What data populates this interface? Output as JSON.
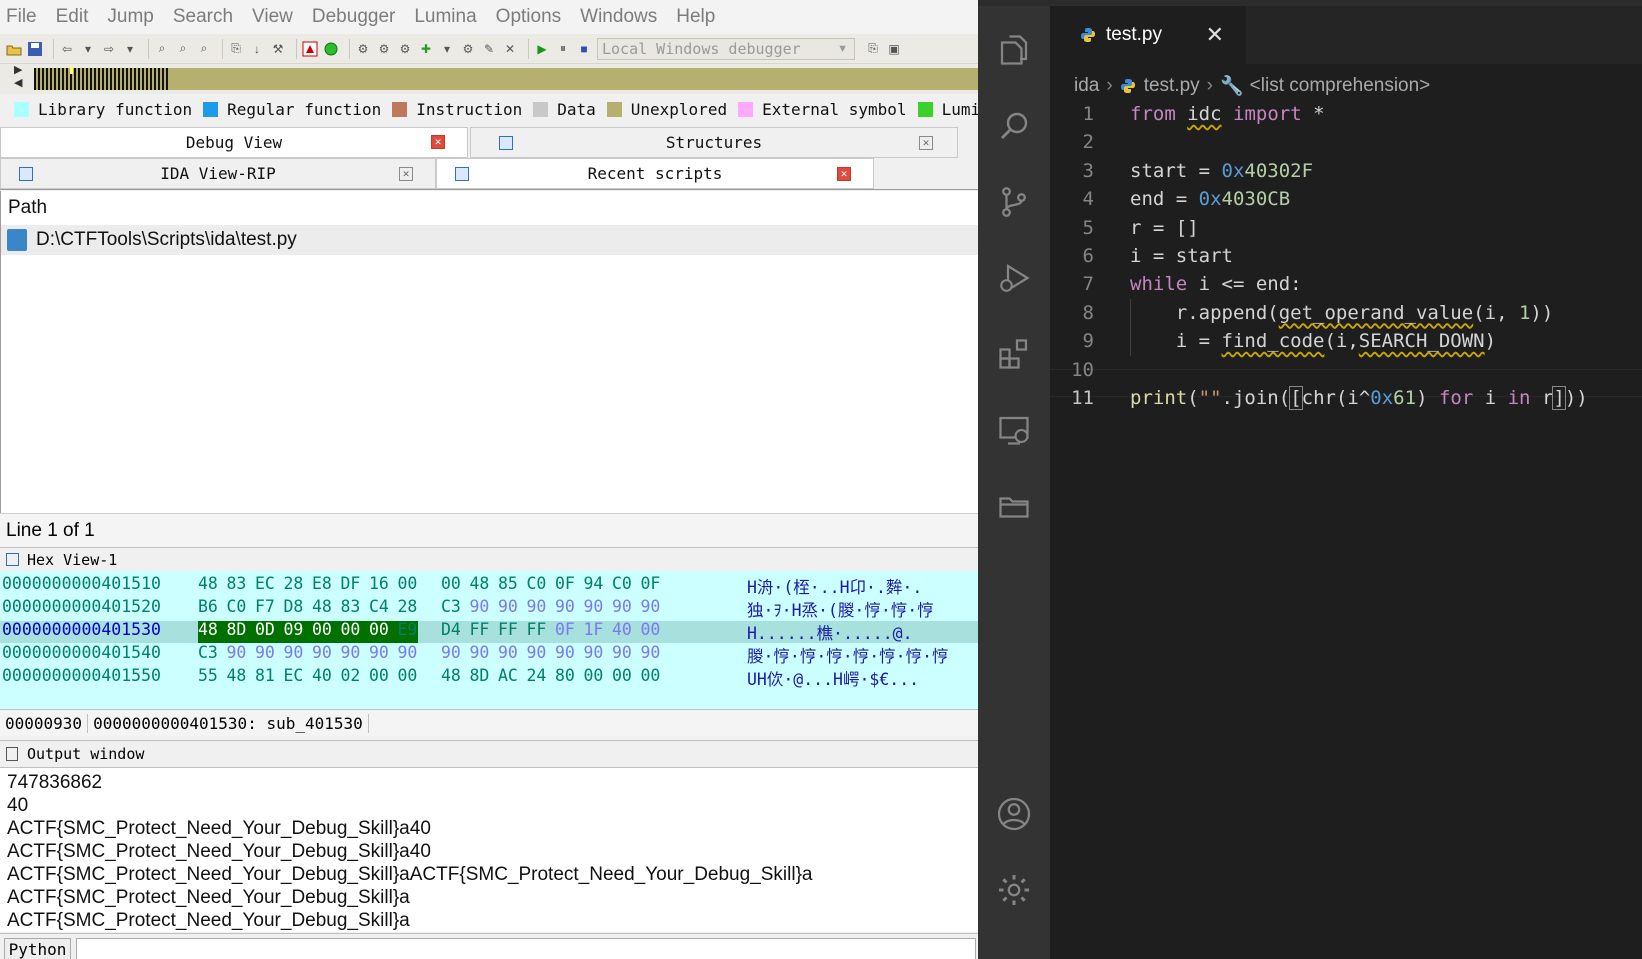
{
  "ida": {
    "menu": [
      "File",
      "Edit",
      "Jump",
      "Search",
      "View",
      "Debugger",
      "Lumina",
      "Options",
      "Windows",
      "Help"
    ],
    "debugger_select": "Local Windows debugger",
    "legend": [
      {
        "label": "Library function",
        "color": "#aaffff"
      },
      {
        "label": "Regular function",
        "color": "#1b9bea"
      },
      {
        "label": "Instruction",
        "color": "#c0785a"
      },
      {
        "label": "Data",
        "color": "#c8c8c8"
      },
      {
        "label": "Unexplored",
        "color": "#b5b06e"
      },
      {
        "label": "External symbol",
        "color": "#ffa8ff"
      },
      {
        "label": "Lumina function",
        "color": "#3ad12a"
      }
    ],
    "tabs_row1": [
      "Debug View",
      "Structures"
    ],
    "tabs_row2": [
      "IDA View-RIP",
      "Recent scripts"
    ],
    "scripts": {
      "header": "Path",
      "items": [
        "D:\\CTFTools\\Scripts\\ida\\test.py"
      ]
    },
    "line_info": "Line 1 of 1",
    "hex": {
      "title": "Hex View-1",
      "rows": [
        {
          "addr": "0000000000401510",
          "bytes": [
            "48",
            "83",
            "EC",
            "28",
            "E8",
            "DF",
            "16",
            "00",
            "00",
            "48",
            "85",
            "C0",
            "0F",
            "94",
            "C0",
            "0F"
          ],
          "ascii": "H洀·(桎·..H卬·.麰·."
        },
        {
          "addr": "0000000000401520",
          "bytes": [
            "B6",
            "C0",
            "F7",
            "D8",
            "48",
            "83",
            "C4",
            "28",
            "C3",
            "90",
            "90",
            "90",
            "90",
            "90",
            "90",
            "90"
          ],
          "ascii": "独·ｦ·H烝·(朡·悙·悙·悙"
        },
        {
          "addr": "0000000000401530",
          "bytes": [
            "48",
            "8D",
            "0D",
            "09",
            "00",
            "00",
            "00",
            "E9",
            "D4",
            "FF",
            "FF",
            "FF",
            "0F",
            "1F",
            "40",
            "00"
          ],
          "ascii": "H......樵·.....@."
        },
        {
          "addr": "0000000000401540",
          "bytes": [
            "C3",
            "90",
            "90",
            "90",
            "90",
            "90",
            "90",
            "90",
            "90",
            "90",
            "90",
            "90",
            "90",
            "90",
            "90",
            "90"
          ],
          "ascii": "朡·悙·悙·悙·悙·悙·悙·悙"
        },
        {
          "addr": "0000000000401550",
          "bytes": [
            "55",
            "48",
            "81",
            "EC",
            "40",
            "02",
            "00",
            "00",
            "48",
            "8D",
            "AC",
            "24",
            "80",
            "00",
            "00",
            "00"
          ],
          "ascii": "UH佽·@...H崿·$€..."
        }
      ],
      "status_offset": "00000930",
      "status_location": "0000000000401530: sub_401530"
    },
    "output": {
      "title": "Output window",
      "lines": [
        "747836862",
        "40",
        "ACTF{SMC_Protect_Need_Your_Debug_Skill}a40",
        "ACTF{SMC_Protect_Need_Your_Debug_Skill}a40",
        "ACTF{SMC_Protect_Need_Your_Debug_Skill}aACTF{SMC_Protect_Need_Your_Debug_Skill}a",
        "ACTF{SMC_Protect_Need_Your_Debug_Skill}a",
        "ACTF{SMC_Protect_Need_Your_Debug_Skill}a"
      ]
    },
    "python_button": "Python"
  },
  "vscode": {
    "tab_name": "test.py",
    "breadcrumb": [
      "ida",
      "test.py",
      "<list comprehension>"
    ],
    "line_numbers": [
      "1",
      "2",
      "3",
      "4",
      "5",
      "6",
      "7",
      "8",
      "9",
      "10",
      "11"
    ],
    "activity_icons": [
      "explorer-icon",
      "search-icon",
      "source-control-icon",
      "run-debug-icon",
      "extensions-icon",
      "remote-explorer-icon",
      "folder-icon",
      "account-icon",
      "settings-gear-icon"
    ]
  }
}
